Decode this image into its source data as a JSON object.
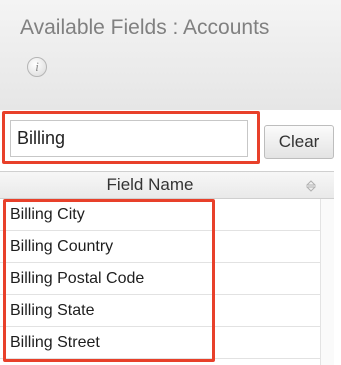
{
  "panel": {
    "title": "Available Fields : Accounts",
    "info_icon": "info-icon",
    "info_glyph": "i"
  },
  "search": {
    "value": "Billing",
    "placeholder": "",
    "clear_label": "Clear"
  },
  "table": {
    "column_header": "Field Name",
    "sort_icon": "sort-icon",
    "items": [
      {
        "label": "Billing City"
      },
      {
        "label": "Billing Country"
      },
      {
        "label": "Billing Postal Code"
      },
      {
        "label": "Billing State"
      },
      {
        "label": "Billing Street"
      }
    ]
  },
  "colors": {
    "highlight": "#e8402a",
    "title_text": "#808080"
  }
}
